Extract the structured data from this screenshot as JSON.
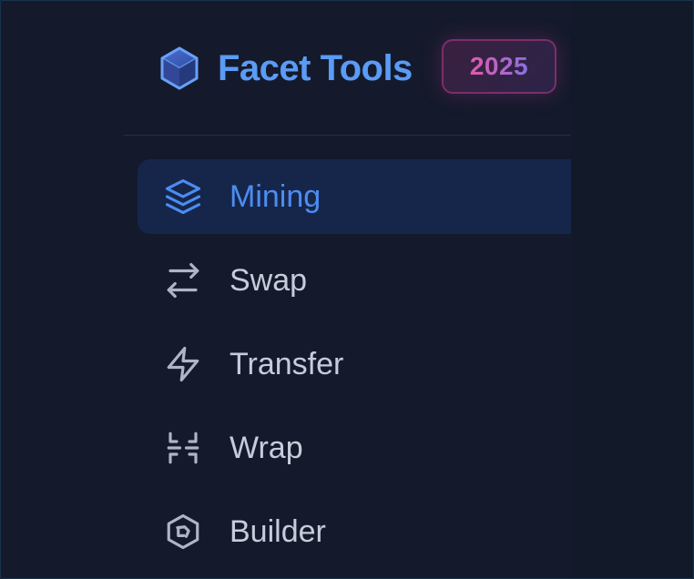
{
  "brand": {
    "name": "Facet Tools",
    "year_badge": "2025",
    "logo_icon": "cube-icon"
  },
  "nav": {
    "items": [
      {
        "label": "Mining",
        "icon": "layers-icon",
        "active": true
      },
      {
        "label": "Swap",
        "icon": "swap-arrows-icon",
        "active": false
      },
      {
        "label": "Transfer",
        "icon": "lightning-icon",
        "active": false
      },
      {
        "label": "Wrap",
        "icon": "wrap-brackets-icon",
        "active": false
      },
      {
        "label": "Builder",
        "icon": "hexagon-builder-icon",
        "active": false
      }
    ]
  },
  "colors": {
    "background": "#141a2b",
    "accent": "#4c8df2",
    "brand_text": "#5a9bf5",
    "active_bg": "#16264a",
    "nav_text": "#c6ccd9",
    "badge_gradient_start": "#e05aa9",
    "badge_gradient_end": "#8a6fe0"
  }
}
